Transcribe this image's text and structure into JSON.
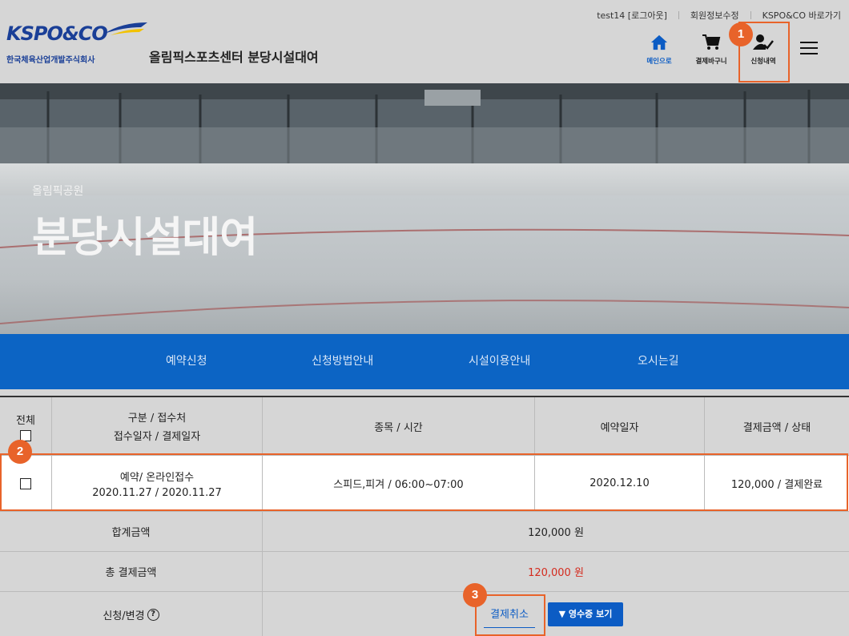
{
  "header": {
    "top_links": [
      "test14 [로그아웃]",
      "회원정보수정",
      "KSPO&CO 바로가기"
    ],
    "logo_text": "KSPO&CO",
    "logo_subtext": "한국체육산업개발주식회사",
    "site_title": "올림픽스포츠센터 분당시설대여",
    "nav_icons": [
      {
        "icon": "home-icon",
        "label": "메인으로"
      },
      {
        "icon": "cart-icon",
        "label": "결제바구니"
      },
      {
        "icon": "user-check-icon",
        "label": "신청내역"
      }
    ],
    "menu_icon": "hamburger-menu-icon"
  },
  "hero": {
    "subtitle": "올림픽공원",
    "title": "분당시설대여"
  },
  "tabs": [
    "예약신청",
    "신청방법안내",
    "시설이용안내",
    "오시는길"
  ],
  "table": {
    "headers": {
      "select_all": "전체",
      "type_line1": "구분 / 접수처",
      "type_line2": "접수일자 / 결제일자",
      "event_time": "종목 / 시간",
      "reservation_date": "예약일자",
      "amount_status": "결제금액 / 상태"
    },
    "rows": [
      {
        "type": "예약/ 온라인접수",
        "dates": "2020.11.27 / 2020.11.27",
        "event_time": "스피드,피겨 / 06:00~07:00",
        "reservation_date": "2020.12.10",
        "amount_status": "120,000 / 결제완료"
      }
    ],
    "summary": {
      "subtotal_label": "합계금액",
      "subtotal_value": "120,000 원",
      "total_label": "총 결제금액",
      "total_value": "120,000 원",
      "change_label": "신청/변경",
      "help_glyph": "?",
      "cancel_button": "결제취소",
      "receipt_button": "▼ 영수증 보기"
    }
  },
  "annotations": [
    "1",
    "2",
    "3"
  ],
  "colors": {
    "brand_blue": "#0c64c4",
    "highlight": "#e8632a",
    "total_red": "#d42b1e"
  }
}
